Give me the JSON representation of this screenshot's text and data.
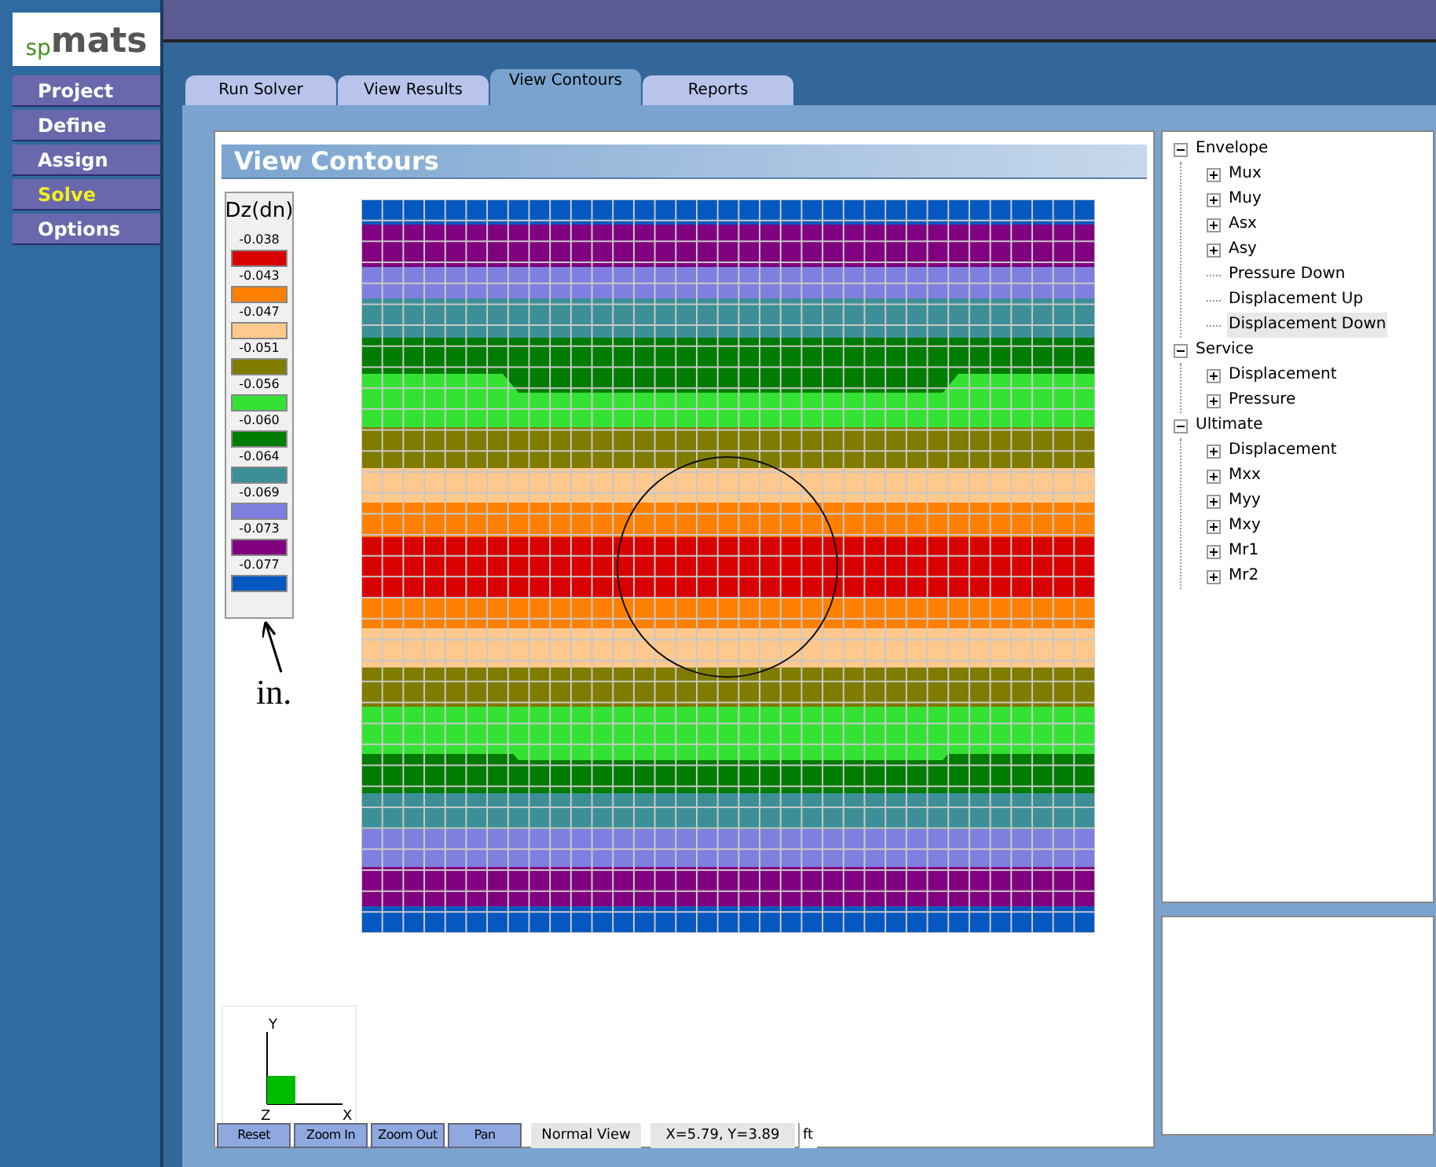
{
  "logo": {
    "prefix": "sp",
    "name": "mats"
  },
  "nav": [
    {
      "label": "Project",
      "selected": false
    },
    {
      "label": "Define",
      "selected": false
    },
    {
      "label": "Assign",
      "selected": false
    },
    {
      "label": "Solve",
      "selected": true
    },
    {
      "label": "Options",
      "selected": false
    }
  ],
  "tabs": [
    {
      "label": "Run Solver",
      "selected": false
    },
    {
      "label": "View Results",
      "selected": false
    },
    {
      "label": "View Contours",
      "selected": true
    },
    {
      "label": "Reports",
      "selected": false
    }
  ],
  "panel_title": "View Contours",
  "legend": {
    "title": "Dz(dn)",
    "items": [
      {
        "value": "-0.038",
        "color": "#d80000"
      },
      {
        "value": "-0.043",
        "color": "#ff8000"
      },
      {
        "value": "-0.047",
        "color": "#ffc88c"
      },
      {
        "value": "-0.051",
        "color": "#807c00"
      },
      {
        "value": "-0.056",
        "color": "#34e234"
      },
      {
        "value": "-0.060",
        "color": "#007c00"
      },
      {
        "value": "-0.064",
        "color": "#3c8f97"
      },
      {
        "value": "-0.069",
        "color": "#7f7fdf"
      },
      {
        "value": "-0.073",
        "color": "#800080"
      },
      {
        "value": "-0.077",
        "color": "#0458c0"
      }
    ]
  },
  "annotation": "in.",
  "axes": {
    "y": "Y",
    "z": "Z",
    "x": "X"
  },
  "tree": [
    {
      "label": "Envelope",
      "kind": "node",
      "expanded": true,
      "selected": false,
      "children": [
        {
          "label": "Mux",
          "kind": "node",
          "expanded": false,
          "selected": false
        },
        {
          "label": "Muy",
          "kind": "node",
          "expanded": false,
          "selected": false
        },
        {
          "label": "Asx",
          "kind": "node",
          "expanded": false,
          "selected": false
        },
        {
          "label": "Asy",
          "kind": "node",
          "expanded": false,
          "selected": false
        },
        {
          "label": "Pressure Down",
          "kind": "leaf",
          "selected": false
        },
        {
          "label": "Displacement Up",
          "kind": "leaf",
          "selected": false
        },
        {
          "label": "Displacement Down",
          "kind": "leaf",
          "selected": true
        }
      ]
    },
    {
      "label": "Service",
      "kind": "node",
      "expanded": true,
      "selected": false,
      "children": [
        {
          "label": "Displacement",
          "kind": "node",
          "expanded": false,
          "selected": false
        },
        {
          "label": "Pressure",
          "kind": "node",
          "expanded": false,
          "selected": false
        }
      ]
    },
    {
      "label": "Ultimate",
      "kind": "node",
      "expanded": true,
      "selected": false,
      "children": [
        {
          "label": "Displacement",
          "kind": "node",
          "expanded": false,
          "selected": false
        },
        {
          "label": "Mxx",
          "kind": "node",
          "expanded": false,
          "selected": false
        },
        {
          "label": "Myy",
          "kind": "node",
          "expanded": false,
          "selected": false
        },
        {
          "label": "Mxy",
          "kind": "node",
          "expanded": false,
          "selected": false
        },
        {
          "label": "Mr1",
          "kind": "node",
          "expanded": false,
          "selected": false
        },
        {
          "label": "Mr2",
          "kind": "node",
          "expanded": false,
          "selected": false
        }
      ]
    }
  ],
  "toolbar": [
    "Reset",
    "Zoom In",
    "Zoom Out",
    "Pan"
  ],
  "status": [
    "Normal View",
    "X=5.79, Y=3.89",
    "ft"
  ]
}
